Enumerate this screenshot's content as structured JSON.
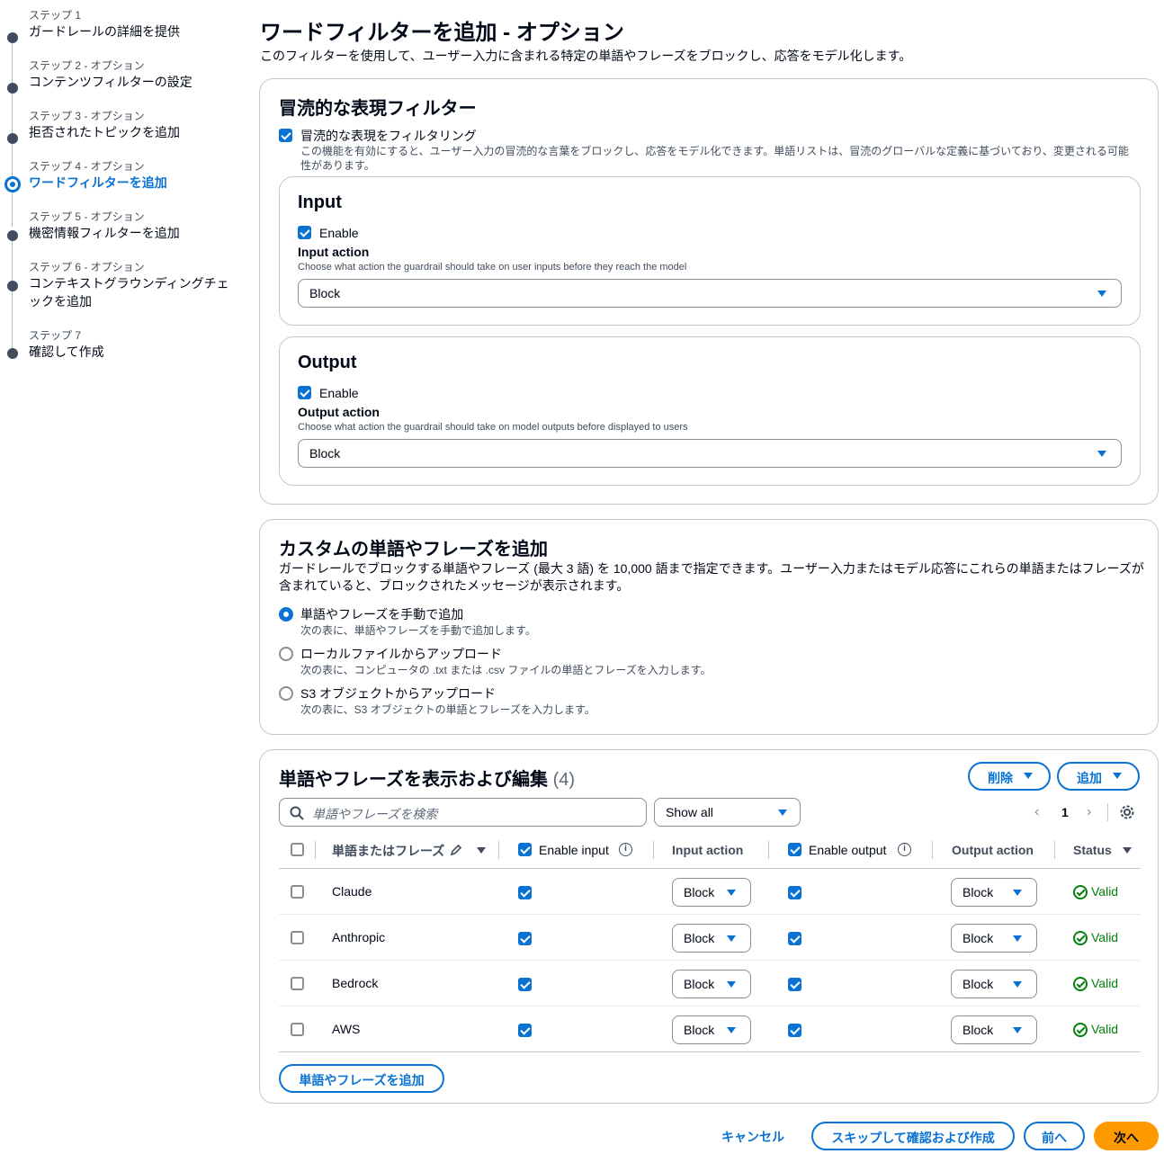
{
  "steps": [
    {
      "sub": "ステップ 1",
      "title": "ガードレールの詳細を提供"
    },
    {
      "sub": "ステップ 2 - オプション",
      "title": "コンテンツフィルターの設定"
    },
    {
      "sub": "ステップ 3 - オプション",
      "title": "拒否されたトピックを追加"
    },
    {
      "sub": "ステップ 4 - オプション",
      "title": "ワードフィルターを追加"
    },
    {
      "sub": "ステップ 5 - オプション",
      "title": "機密情報フィルターを追加"
    },
    {
      "sub": "ステップ 6 - オプション",
      "title": "コンテキストグラウンディングチェックを追加"
    },
    {
      "sub": "ステップ 7",
      "title": "確認して作成"
    }
  ],
  "header": {
    "title": "ワードフィルターを追加 - オプション",
    "description": "このフィルターを使用して、ユーザー入力に含まれる特定の単語やフレーズをブロックし、応答をモデル化します。"
  },
  "profanity": {
    "title": "冒涜的な表現フィルター",
    "checkbox_label": "冒涜的な表現をフィルタリング",
    "checkbox_desc": "この機能を有効にすると、ユーザー入力の冒涜的な言葉をブロックし、応答をモデル化できます。単語リストは、冒涜のグローバルな定義に基づいており、変更される可能性があります。",
    "input": {
      "title": "Input",
      "enable": "Enable",
      "action_label": "Input action",
      "action_desc": "Choose what action the guardrail should take on user inputs before they reach the model",
      "value": "Block"
    },
    "output": {
      "title": "Output",
      "enable": "Enable",
      "action_label": "Output action",
      "action_desc": "Choose what action the guardrail should take on model outputs before displayed to users",
      "value": "Block"
    }
  },
  "custom": {
    "title": "カスタムの単語やフレーズを追加",
    "desc_line1": "ガードレールでブロックする単語やフレーズ (最大 3 語) を 10,000 語まで指定できます。ユーザー入力またはモデル応答にこれらの単語またはフレーズが",
    "desc_line2": "含まれていると、ブロックされたメッセージが表示されます。",
    "options": [
      {
        "label": "単語やフレーズを手動で追加",
        "desc": "次の表に、単語やフレーズを手動で追加します。",
        "selected": true
      },
      {
        "label": "ローカルファイルからアップロード",
        "desc": "次の表に、コンピュータの .txt または .csv ファイルの単語とフレーズを入力します。",
        "selected": false
      },
      {
        "label": "S3 オブジェクトからアップロード",
        "desc": "次の表に、S3 オブジェクトの単語とフレーズを入力します。",
        "selected": false
      }
    ]
  },
  "table": {
    "title": "単語やフレーズを表示および編集",
    "count": "(4)",
    "delete_btn": "削除",
    "add_btn": "追加",
    "search_placeholder": "単語やフレーズを検索",
    "filter": "Show all",
    "page": "1",
    "columns": {
      "phrase": "単語またはフレーズ",
      "enable_input": "Enable input",
      "input_action": "Input action",
      "enable_output": "Enable output",
      "output_action": "Output action",
      "status": "Status"
    },
    "rows": [
      {
        "phrase": "Claude",
        "input_action": "Block",
        "output_action": "Block",
        "status": "Valid"
      },
      {
        "phrase": "Anthropic",
        "input_action": "Block",
        "output_action": "Block",
        "status": "Valid"
      },
      {
        "phrase": "Bedrock",
        "input_action": "Block",
        "output_action": "Block",
        "status": "Valid"
      },
      {
        "phrase": "AWS",
        "input_action": "Block",
        "output_action": "Block",
        "status": "Valid"
      }
    ],
    "add_phrase_btn": "単語やフレーズを追加"
  },
  "footer": {
    "cancel": "キャンセル",
    "skip": "スキップして確認および作成",
    "prev": "前へ",
    "next": "次へ"
  },
  "colors": {
    "accent": "#0972d3",
    "primary_button": "#ff9900",
    "valid": "#037f0c"
  }
}
